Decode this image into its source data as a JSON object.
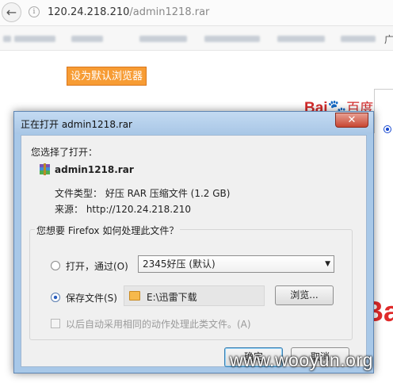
{
  "browser": {
    "url_host": "120.24.218.210",
    "url_path": "/admin1218.rar",
    "bookmark_end": "广"
  },
  "page": {
    "set_default_label": "设为默认浏览器",
    "baidu_logo_left": "Bai",
    "baidu_logo_paw": "🐾",
    "baidu_logo_right": "百度",
    "baidu_big": "Ba"
  },
  "dialog": {
    "title": "正在打开 admin1218.rar",
    "close": "✕",
    "chose_label": "您选择了打开：",
    "file_name": "admin1218.rar",
    "file_type": "文件类型： 好压 RAR 压缩文件 (1.2 GB)",
    "source": "来源：  http://120.24.218.210",
    "group_label": "您想要 Firefox 如何处理此文件？",
    "open_with_label": "打开，通过(O)",
    "open_with_app": "2345好压 (默认)",
    "save_label": "保存文件(S)",
    "save_path": "E:\\迅雷下载",
    "browse_label": "浏览...",
    "remember_label": "以后自动采用相同的动作处理此类文件。(A)",
    "ok_label": "确定",
    "cancel_label": "取消"
  },
  "watermark": "www.wooyun.org",
  "icons": [
    "back-arrow-icon",
    "info-icon",
    "rar-file-icon",
    "folder-icon",
    "close-icon",
    "dropdown-arrow-icon"
  ]
}
